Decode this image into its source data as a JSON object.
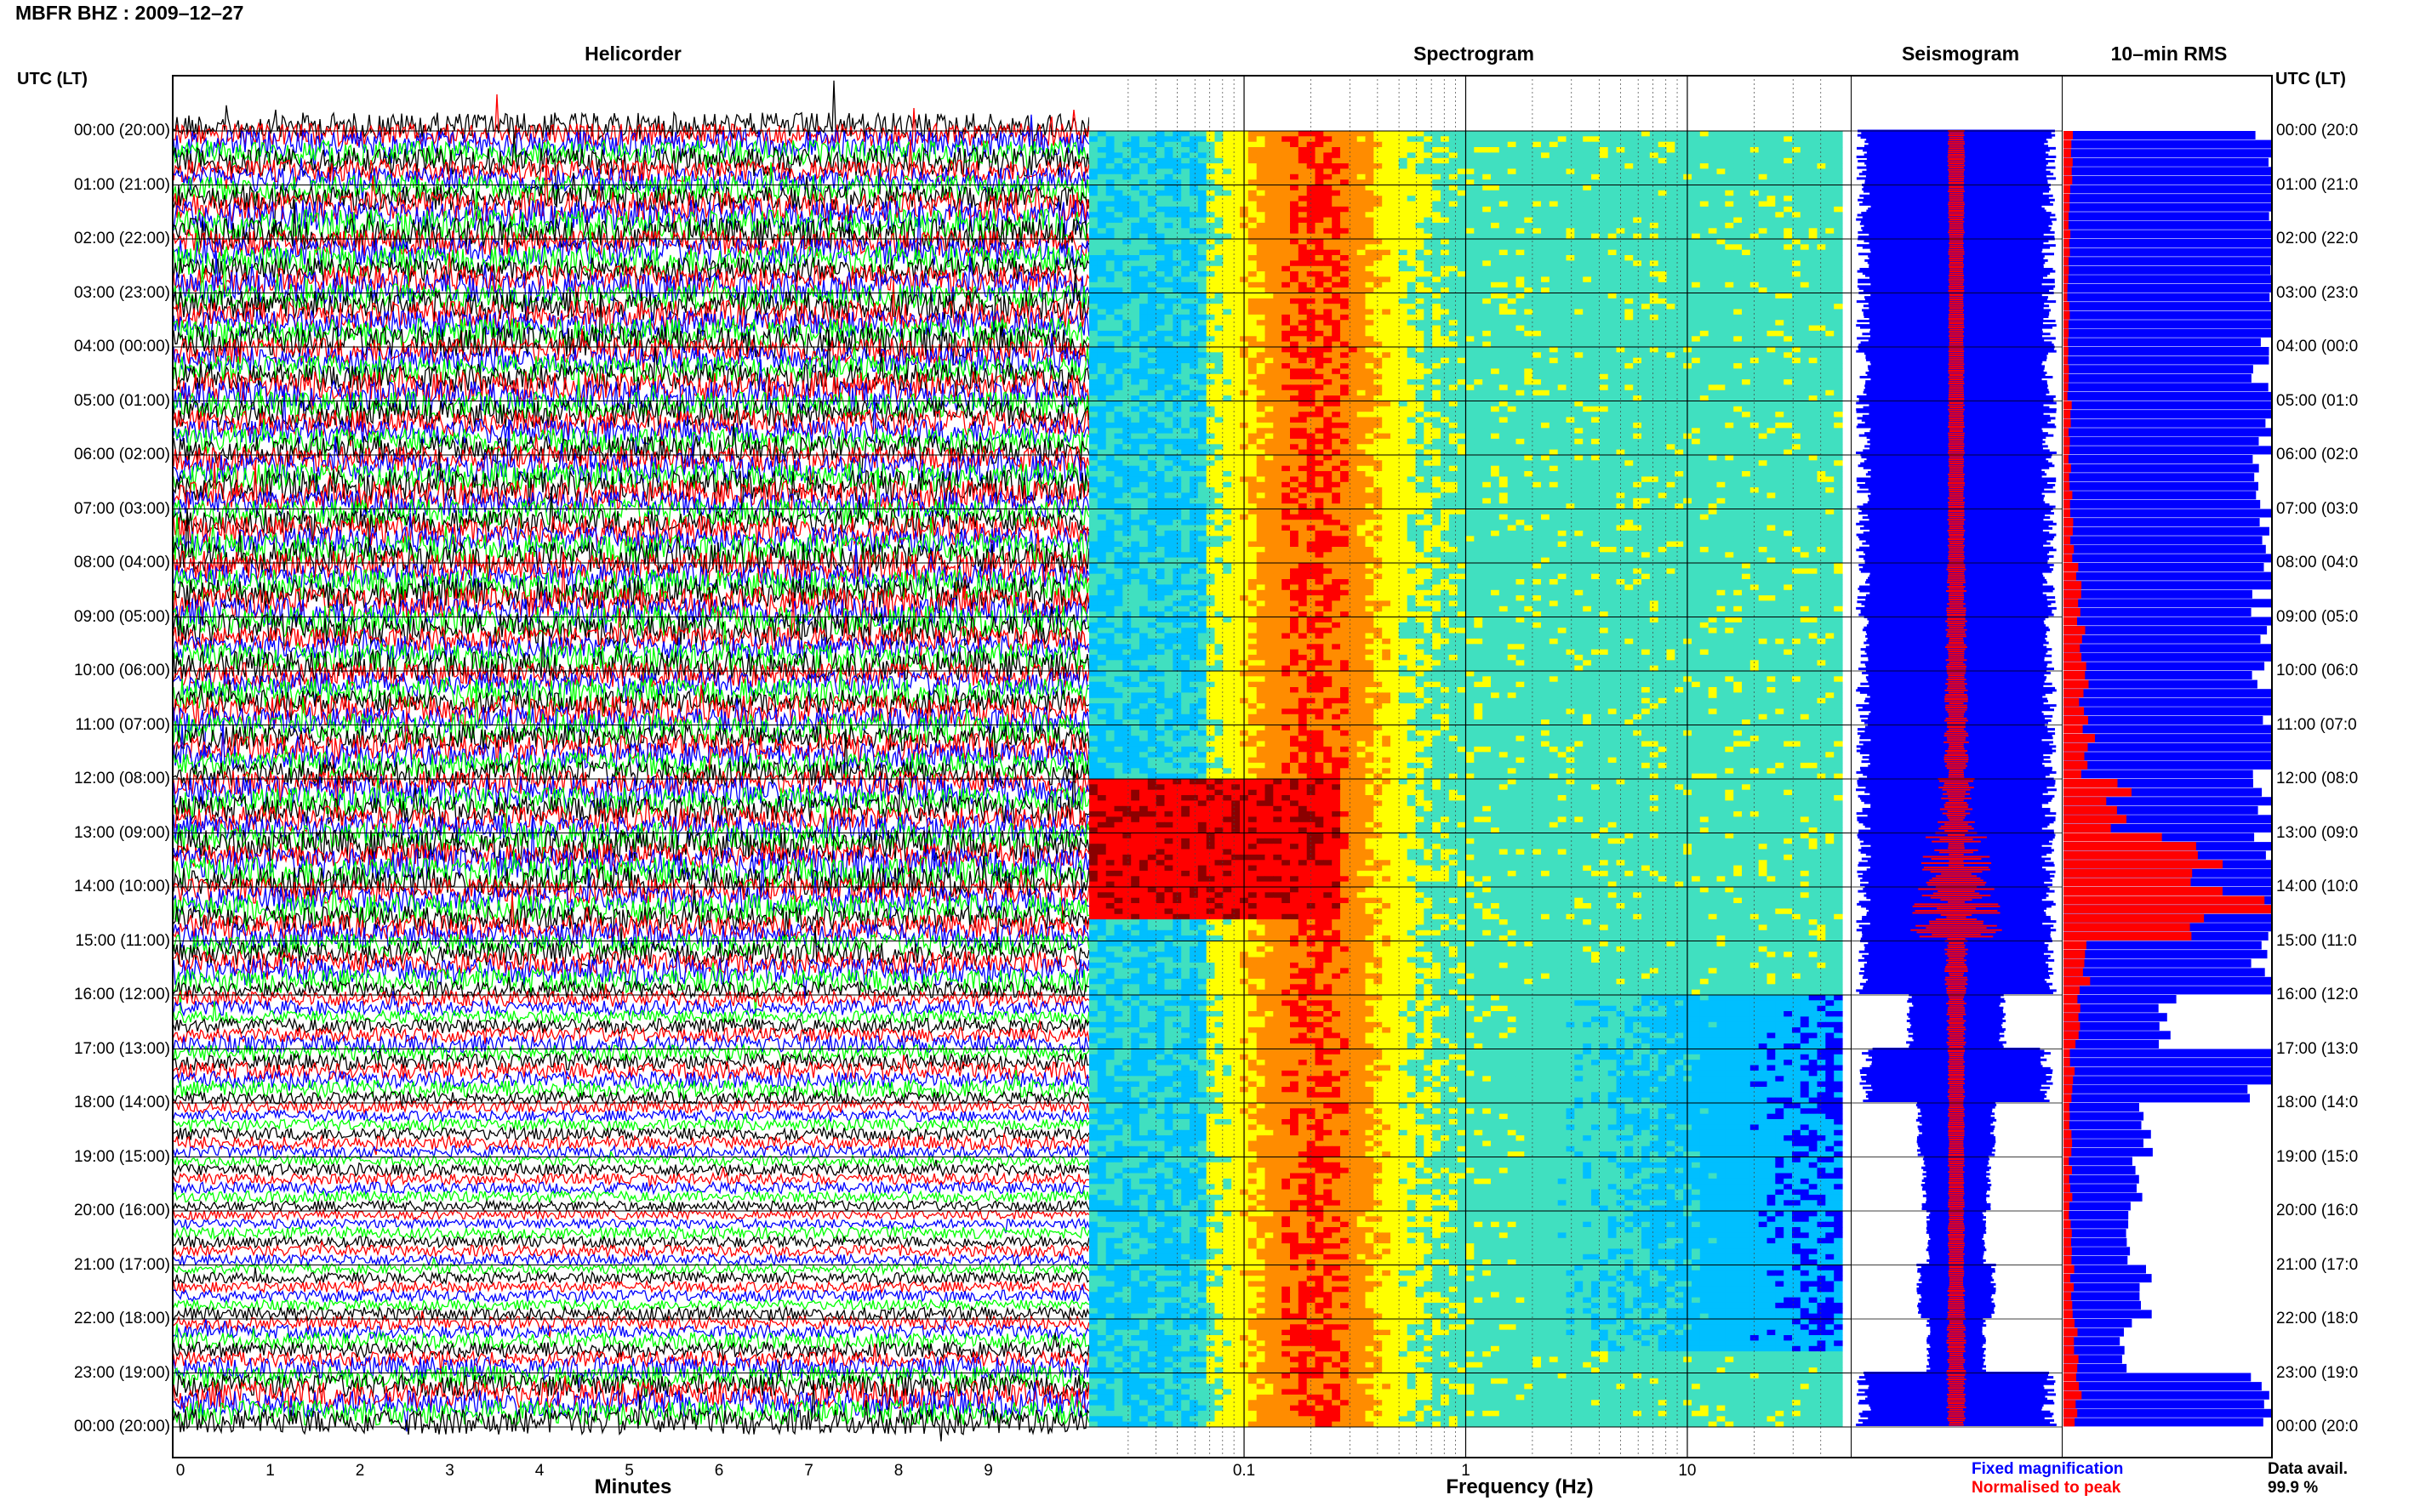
{
  "title": "MBFR BHZ : 2009–12–27",
  "panels": {
    "helicorder": "Helicorder",
    "spectrogram": "Spectrogram",
    "seismogram": "Seismogram",
    "rms": "10–min RMS"
  },
  "utc_header_left": "UTC (LT)",
  "utc_header_right": "UTC (LT)",
  "hour_labels": [
    "00:00 (20:00)",
    "01:00 (21:00)",
    "02:00 (22:00)",
    "03:00 (23:00)",
    "04:00 (00:00)",
    "05:00 (01:00)",
    "06:00 (02:00)",
    "07:00 (03:00)",
    "08:00 (04:00)",
    "09:00 (05:00)",
    "10:00 (06:00)",
    "11:00 (07:00)",
    "12:00 (08:00)",
    "13:00 (09:00)",
    "14:00 (10:00)",
    "15:00 (11:00)",
    "16:00 (12:00)",
    "17:00 (13:00)",
    "18:00 (14:00)",
    "19:00 (15:00)",
    "20:00 (16:00)",
    "21:00 (17:00)",
    "22:00 (18:00)",
    "23:00 (19:00)",
    "00:00 (20:00)"
  ],
  "hour_labels_right": [
    "00:00 (20:0",
    "01:00 (21:0",
    "02:00 (22:0",
    "03:00 (23:0",
    "04:00 (00:0",
    "05:00 (01:0",
    "06:00 (02:0",
    "07:00 (03:0",
    "08:00 (04:0",
    "09:00 (05:0",
    "10:00 (06:0",
    "11:00 (07:0",
    "12:00 (08:0",
    "13:00 (09:0",
    "14:00 (10:0",
    "15:00 (11:0",
    "16:00 (12:0",
    "17:00 (13:0",
    "18:00 (14:0",
    "19:00 (15:0",
    "20:00 (16:0",
    "21:00 (17:0",
    "22:00 (18:0",
    "23:00 (19:0",
    "00:00 (20:0"
  ],
  "helicorder_axis": {
    "label": "Minutes",
    "ticks": [
      "0",
      "1",
      "2",
      "3",
      "4",
      "5",
      "6",
      "7",
      "8",
      "9"
    ]
  },
  "spectrogram_axis": {
    "label": "Frequency (Hz)",
    "ticks": [
      "0.1",
      "1",
      "10"
    ]
  },
  "legend": {
    "fixed": "Fixed magnification",
    "normalised": "Normalised to peak",
    "fixed_color": "#0000ff",
    "normalised_color": "#ff0000"
  },
  "availability": {
    "label": "Data avail.",
    "value": "99.9 %"
  },
  "colors": {
    "trace": [
      "#000000",
      "#ff0000",
      "#0000ff",
      "#00ff00"
    ],
    "rms_fixed": "#0000ff",
    "rms_norm": "#ff0000",
    "spectro_cmap": [
      "#00008b",
      "#0000ff",
      "#00bfff",
      "#40e0c0",
      "#ffff00",
      "#ff8c00",
      "#ff0000",
      "#8b0000"
    ]
  },
  "chart_data": [
    {
      "type": "line",
      "name": "helicorder",
      "title": "Helicorder",
      "xlabel": "Minutes",
      "xlim": [
        0,
        10
      ],
      "x_ticks": [
        0,
        1,
        2,
        3,
        4,
        5,
        6,
        7,
        8,
        9
      ],
      "ylabel": "UTC (LT)",
      "lines_per_hour": 6,
      "hours": 24,
      "hourly_activity_level": [
        0.9,
        1.0,
        1.0,
        1.0,
        1.0,
        1.0,
        1.0,
        1.0,
        1.0,
        1.0,
        1.0,
        1.0,
        1.0,
        1.0,
        1.0,
        0.8,
        0.45,
        0.5,
        0.35,
        0.3,
        0.28,
        0.3,
        0.45,
        0.85
      ]
    },
    {
      "type": "heatmap",
      "name": "spectrogram",
      "title": "Spectrogram",
      "xlabel": "Frequency (Hz)",
      "xscale": "log",
      "xlim": [
        0.02,
        50
      ],
      "x_ticks": [
        0.1,
        1,
        10
      ],
      "hours": 24,
      "band_peak_hz": 0.2,
      "strong_interval_utc": [
        "12:00",
        "14:30"
      ],
      "quiet_high_freq_interval_utc": [
        "16:00",
        "22:30"
      ]
    },
    {
      "type": "bar",
      "name": "10-min RMS",
      "title": "10–min RMS",
      "orientation": "horizontal",
      "bins": 144,
      "series": [
        {
          "name": "Fixed magnification",
          "description": "hourly relative RMS (fixed scale, clipped at 1.0)",
          "values": [
            1,
            1,
            1,
            1,
            1,
            1,
            1,
            1,
            1,
            1,
            1,
            1,
            1,
            1,
            1,
            1,
            0.5,
            0.98,
            0.4,
            0.35,
            0.3,
            0.4,
            0.3,
            1
          ]
        },
        {
          "name": "Normalised to peak",
          "description": "hourly relative RMS normalised to peak",
          "values": [
            0.05,
            0.04,
            0.03,
            0.03,
            0.03,
            0.04,
            0.04,
            0.05,
            0.08,
            0.1,
            0.12,
            0.14,
            0.3,
            0.7,
            1.0,
            0.12,
            0.08,
            0.05,
            0.04,
            0.04,
            0.04,
            0.05,
            0.07,
            0.08
          ]
        }
      ]
    }
  ]
}
